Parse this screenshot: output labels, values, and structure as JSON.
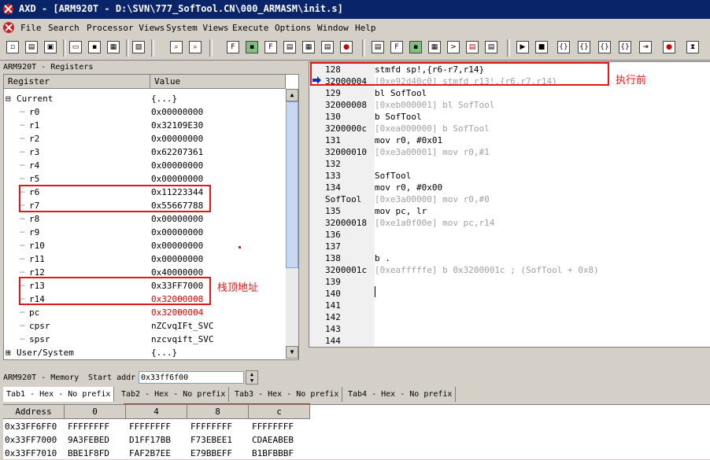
{
  "window": {
    "title": "AXD - [ARM920T - D:\\SVN\\777_SofTool.CN\\000_ARMASM\\init.s]"
  },
  "menu": [
    "File",
    "Search",
    "Processor Views",
    "System Views",
    "Execute",
    "Options",
    "Window",
    "Help"
  ],
  "registers": {
    "pane_title": "ARM920T - Registers",
    "col_register": "Register",
    "col_value": "Value",
    "group": "Current",
    "group_value": "{...}",
    "rows": [
      {
        "name": "r0",
        "value": "0x00000000"
      },
      {
        "name": "r1",
        "value": "0x32109E30"
      },
      {
        "name": "r2",
        "value": "0x00000000"
      },
      {
        "name": "r3",
        "value": "0x62207361"
      },
      {
        "name": "r4",
        "value": "0x00000000"
      },
      {
        "name": "r5",
        "value": "0x00000000"
      },
      {
        "name": "r6",
        "value": "0x11223344"
      },
      {
        "name": "r7",
        "value": "0x55667788"
      },
      {
        "name": "r8",
        "value": "0x00000000"
      },
      {
        "name": "r9",
        "value": "0x00000000"
      },
      {
        "name": "r10",
        "value": "0x00000000"
      },
      {
        "name": "r11",
        "value": "0x00000000"
      },
      {
        "name": "r12",
        "value": "0x40000000"
      },
      {
        "name": "r13",
        "value": "0x33FF7000"
      },
      {
        "name": "r14",
        "value": "0x32000008"
      },
      {
        "name": "pc",
        "value": "0x32000004"
      },
      {
        "name": "cpsr",
        "value": "nZCvqIFt_SVC"
      },
      {
        "name": "spsr",
        "value": "nzcvqift_SVC"
      }
    ],
    "group2": "User/System",
    "group2_value": "{...}"
  },
  "code": {
    "lines": [
      {
        "c1": "128",
        "c2": "     stmfd   sp!,{r6-r7,r14}",
        "grey": false
      },
      {
        "c1": "32000004",
        "c2": "[0xe92d40c0]   stmfd    r13!,{r6,r7,r14}",
        "grey": true
      },
      {
        "c1": "129",
        "c2": "     bl SofTool",
        "grey": false
      },
      {
        "c1": "32000008",
        "c2": "[0xeb000001]   bl       SofTool",
        "grey": true
      },
      {
        "c1": "130",
        "c2": "     b SofTool",
        "grey": false
      },
      {
        "c1": "3200000c",
        "c2": "[0xea000000]   b        SofTool",
        "grey": true
      },
      {
        "c1": "131",
        "c2": "     mov r0, #0x01",
        "grey": false
      },
      {
        "c1": "32000010",
        "c2": "[0xe3a00001]   mov      r0,#1",
        "grey": true
      },
      {
        "c1": "132",
        "c2": "",
        "grey": false
      },
      {
        "c1": "133",
        "c2": "SofTool",
        "grey": false
      },
      {
        "c1": "134",
        "c2": "     mov r0, #0x00",
        "grey": false
      },
      {
        "c1": "SofTool",
        "c2": "[0xe3a00000]   mov      r0,#0",
        "grey": true
      },
      {
        "c1": "135",
        "c2": "     mov pc, lr",
        "grey": false
      },
      {
        "c1": "32000018",
        "c2": "[0xe1a0f00e]   mov      pc,r14",
        "grey": true
      },
      {
        "c1": "136",
        "c2": "",
        "grey": false
      },
      {
        "c1": "137",
        "c2": "",
        "grey": false
      },
      {
        "c1": "138",
        "c2": "     b .",
        "grey": false
      },
      {
        "c1": "3200001c",
        "c2": "[0xeafffffe]   b        0x3200001c  ; (SofTool + 0x8)",
        "grey": true
      },
      {
        "c1": "139",
        "c2": "",
        "grey": false
      },
      {
        "c1": "140",
        "c2": "",
        "grey": false
      },
      {
        "c1": "141",
        "c2": "",
        "grey": false
      },
      {
        "c1": "142",
        "c2": "",
        "grey": false
      },
      {
        "c1": "143",
        "c2": "",
        "grey": false
      },
      {
        "c1": "144",
        "c2": "",
        "grey": false
      }
    ]
  },
  "annotations": {
    "before_exec": "执行前",
    "stack_top": "栈顶地址"
  },
  "memory": {
    "pane_title": "ARM920T - Memory",
    "start_label": "Start addr",
    "start_value": "0x33ff6f00",
    "tabs": [
      "Tab1 - Hex - No prefix",
      "Tab2 - Hex - No prefix",
      "Tab3 - Hex - No prefix",
      "Tab4 - Hex - No prefix"
    ],
    "headers": [
      "Address",
      "0",
      "4",
      "8",
      "c"
    ],
    "rows": [
      [
        "0x33FF6FF0",
        "FFFFFFFF",
        "FFFFFFFF",
        "FFFFFFFF",
        "FFFFFFFF"
      ],
      [
        "0x33FF7000",
        "9A3FEBED",
        "D1FF17BB",
        "F73EBEE1",
        "CDAEABEB"
      ],
      [
        "0x33FF7010",
        "BBE1F8FD",
        "FAF2B7EE",
        "E79BBEFF",
        "B1BFBBBF"
      ]
    ]
  },
  "colors": {
    "highlight_red": "#e01818",
    "changed_value": "#e00000",
    "title_bar": "#0a246a"
  }
}
